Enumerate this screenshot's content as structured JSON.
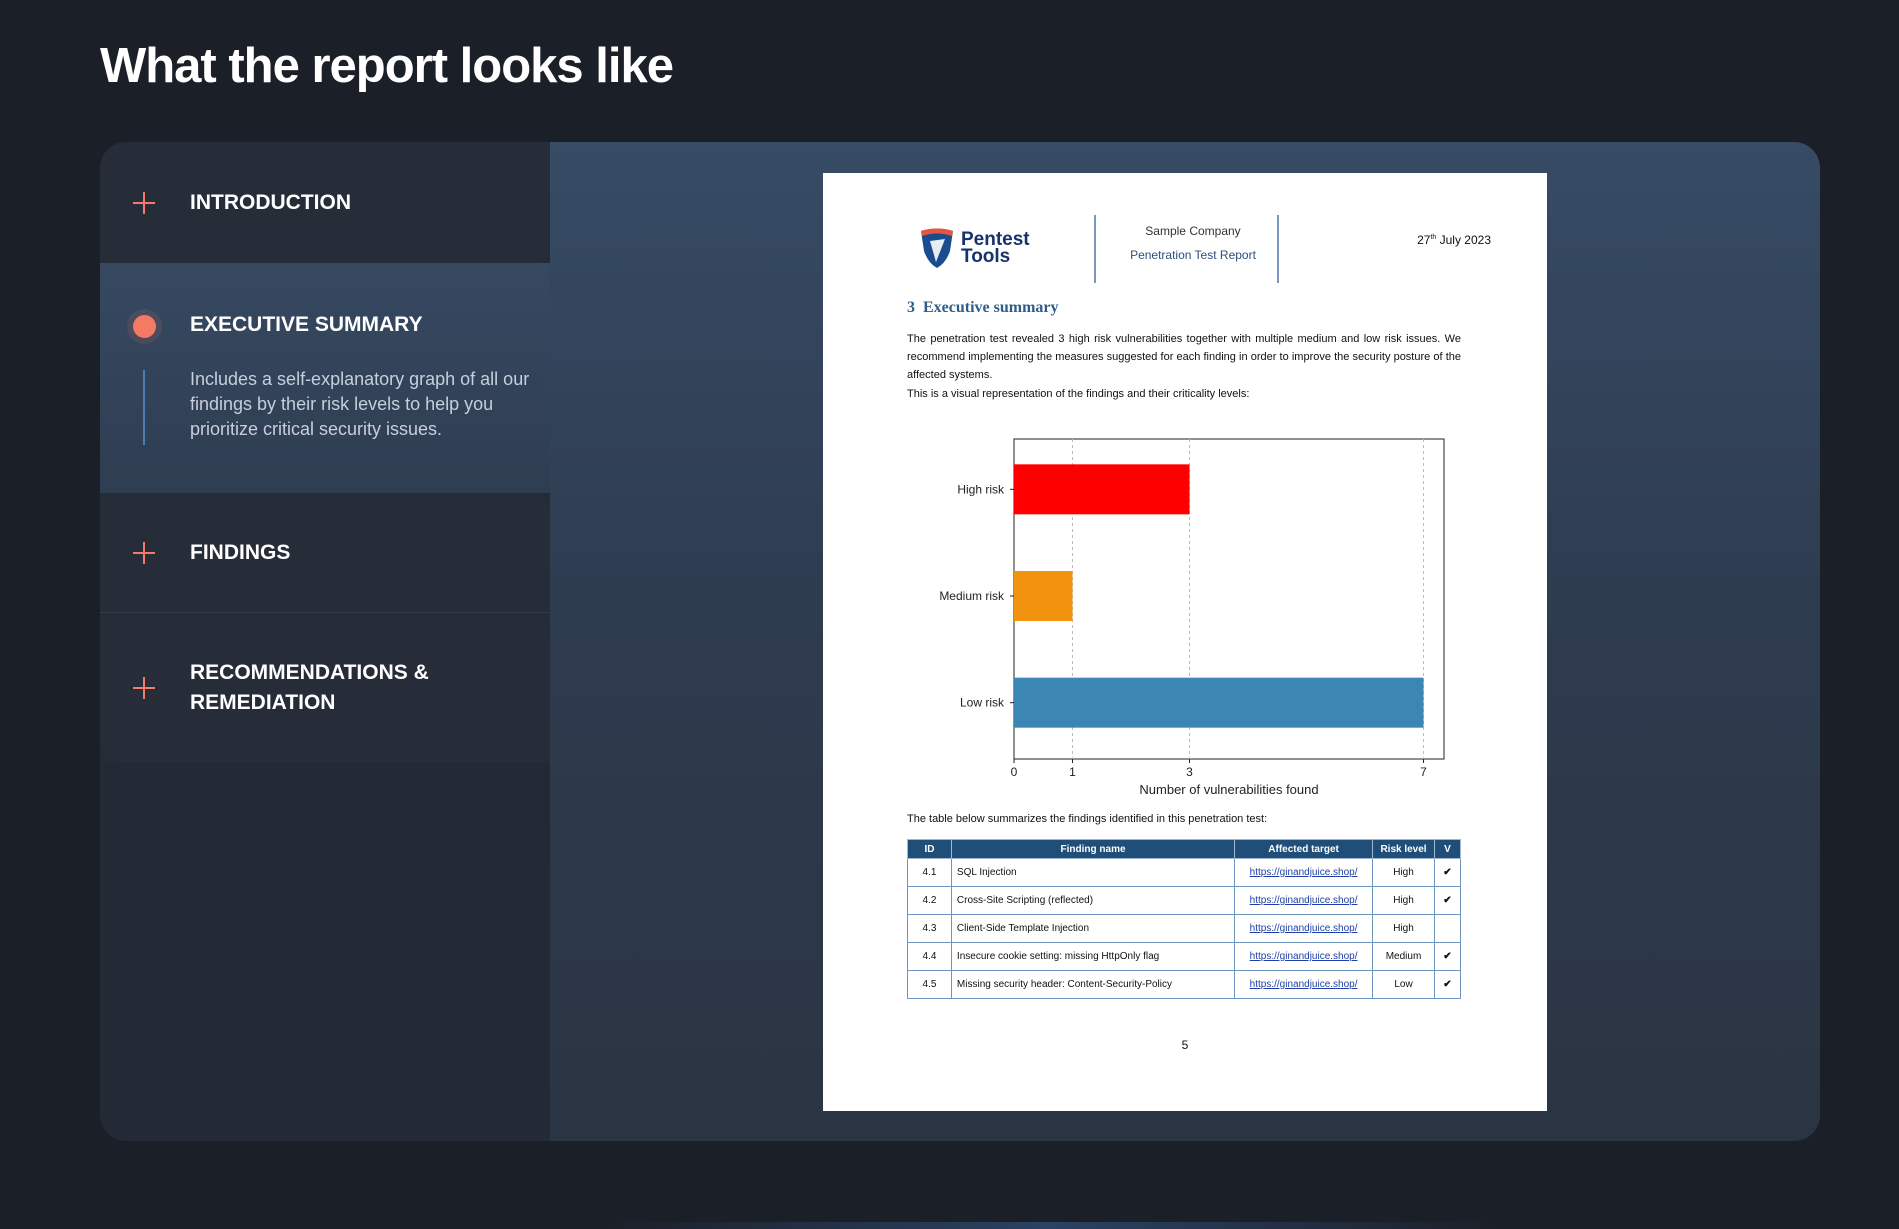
{
  "page": {
    "title": "What the report looks like"
  },
  "accordion": {
    "items": [
      {
        "label": "INTRODUCTION",
        "icon": "plus-icon"
      },
      {
        "label": "EXECUTIVE SUMMARY",
        "icon": "dot-icon",
        "expanded": true,
        "description": "Includes a self-explanatory graph of all our findings by their risk levels to help you prioritize critical security issues."
      },
      {
        "label": "FINDINGS",
        "icon": "plus-icon"
      },
      {
        "label": "RECOMMENDATIONS & REMEDIATION",
        "icon": "plus-icon"
      }
    ],
    "accent_color": "#f47a66"
  },
  "report": {
    "logo_line1": "Pentest",
    "logo_line2": "Tools",
    "company": "Sample Company",
    "report_name": "Penetration Test Report",
    "date_day": "27",
    "date_suffix": "th",
    "date_rest": " July 2023",
    "section_number": "3",
    "section_title": "Executive summary",
    "para1": "The penetration test revealed 3 high risk vulnerabilities together with multiple medium and low risk issues. We recommend implementing the measures suggested for each finding in order to improve the security posture of the affected systems.",
    "para2": "This is a visual representation of the findings and their criticality levels:",
    "para3": "The table below summarizes the findings identified in this penetration test:",
    "page_number": "5",
    "table": {
      "headers": [
        "ID",
        "Finding name",
        "Affected target",
        "Risk level",
        "V"
      ],
      "rows": [
        {
          "id": "4.1",
          "name": "SQL Injection",
          "target": "https://ginandjuice.shop/",
          "risk": "High",
          "verified": "✔"
        },
        {
          "id": "4.2",
          "name": "Cross-Site Scripting (reflected)",
          "target": "https://ginandjuice.shop/",
          "risk": "High",
          "verified": "✔"
        },
        {
          "id": "4.3",
          "name": "Client-Side Template Injection",
          "target": "https://ginandjuice.shop/",
          "risk": "High",
          "verified": ""
        },
        {
          "id": "4.4",
          "name": "Insecure cookie setting: missing HttpOnly flag",
          "target": "https://ginandjuice.shop/",
          "risk": "Medium",
          "verified": "✔"
        },
        {
          "id": "4.5",
          "name": "Missing security header: Content-Security-Policy",
          "target": "https://ginandjuice.shop/",
          "risk": "Low",
          "verified": "✔"
        }
      ]
    }
  },
  "chart_data": {
    "type": "bar",
    "orientation": "horizontal",
    "categories": [
      "High risk",
      "Medium risk",
      "Low risk"
    ],
    "values": [
      3,
      1,
      7
    ],
    "colors": [
      "#ff0000",
      "#f2930f",
      "#3c86b3"
    ],
    "xlabel": "Number of vulnerabilities found",
    "ylabel": "",
    "xticks": [
      0,
      1,
      3,
      7
    ],
    "xlim": [
      0,
      7.35
    ],
    "grid": "vertical dashed at ticks"
  }
}
